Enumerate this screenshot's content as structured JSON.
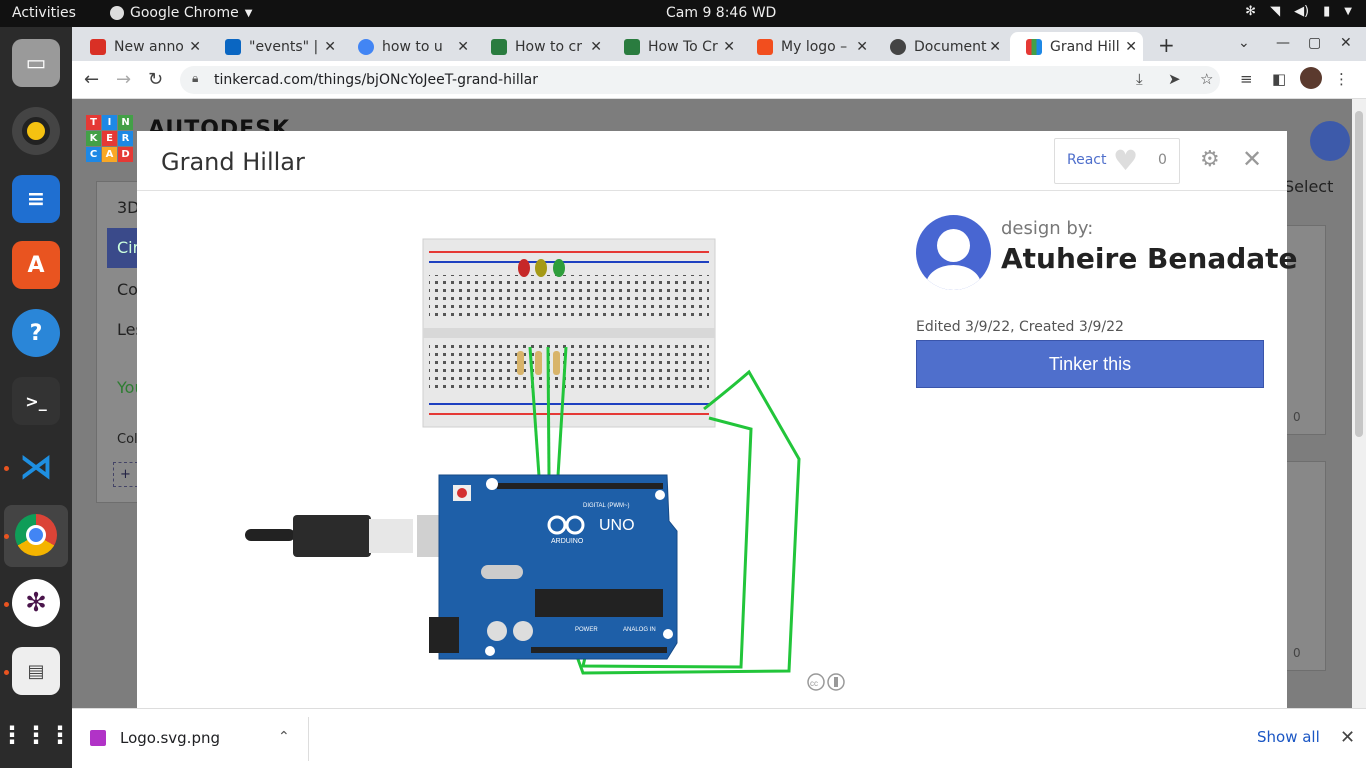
{
  "topbar": {
    "activities": "Activities",
    "app_name": "Google Chrome",
    "clock": "Cam 9   8:46 WD"
  },
  "dock": {
    "items": [
      "files-icon",
      "rhythmbox-icon",
      "writer-icon",
      "software-icon",
      "help-icon",
      "terminal-icon",
      "vscode-icon",
      "chrome-icon",
      "slack-icon",
      "document-viewer-icon",
      "app-grid-icon"
    ]
  },
  "tabs": [
    {
      "title": "New anno",
      "favicon": "gmail-icon",
      "color": "#d93025"
    },
    {
      "title": "\"events\" |",
      "favicon": "linkedin-icon",
      "color": "#0a66c2"
    },
    {
      "title": "how to u",
      "favicon": "google-icon",
      "color": "#4285f4"
    },
    {
      "title": "How to cr",
      "favicon": "wikihow-icon",
      "color": "#2a7c3f"
    },
    {
      "title": "How To Cr",
      "favicon": "wikihow-icon",
      "color": "#2a7c3f"
    },
    {
      "title": "My logo –",
      "favicon": "figma-icon",
      "color": "#f24e1e"
    },
    {
      "title": "Document",
      "favicon": "globe-icon",
      "color": "#444444"
    },
    {
      "title": "Grand Hill",
      "favicon": "tinkercad-icon",
      "color": "#e53935"
    }
  ],
  "address": {
    "url": "tinkercad.com/things/bjONcYoJeeT-grand-hillar"
  },
  "background": {
    "brand": "AUTODESK",
    "logo_letters": [
      "T",
      "I",
      "N",
      "K",
      "E",
      "R",
      "C",
      "A",
      "D"
    ],
    "side_items": [
      "3D",
      "Cir",
      "Co",
      "Les",
      "You",
      "Col",
      "+"
    ],
    "select": "Select",
    "card_count_1": "0",
    "card_count_2": "0"
  },
  "modal": {
    "title": "Grand Hillar",
    "react_label": "React",
    "react_count": "0",
    "designed_by_label": "design by:",
    "designer_name": "Atuheire Benadate",
    "dates": "Edited 3/9/22, Created 3/9/22",
    "cta": "Tinker this",
    "board_labels": {
      "uno": "UNO",
      "arduino": "ARDUINO",
      "digital": "DIGITAL (PWM~)",
      "power": "POWER",
      "analog": "ANALOG IN"
    },
    "accent_color": "#4f6fcc"
  },
  "download": {
    "filename": "Logo.svg.png",
    "show_all": "Show all"
  }
}
